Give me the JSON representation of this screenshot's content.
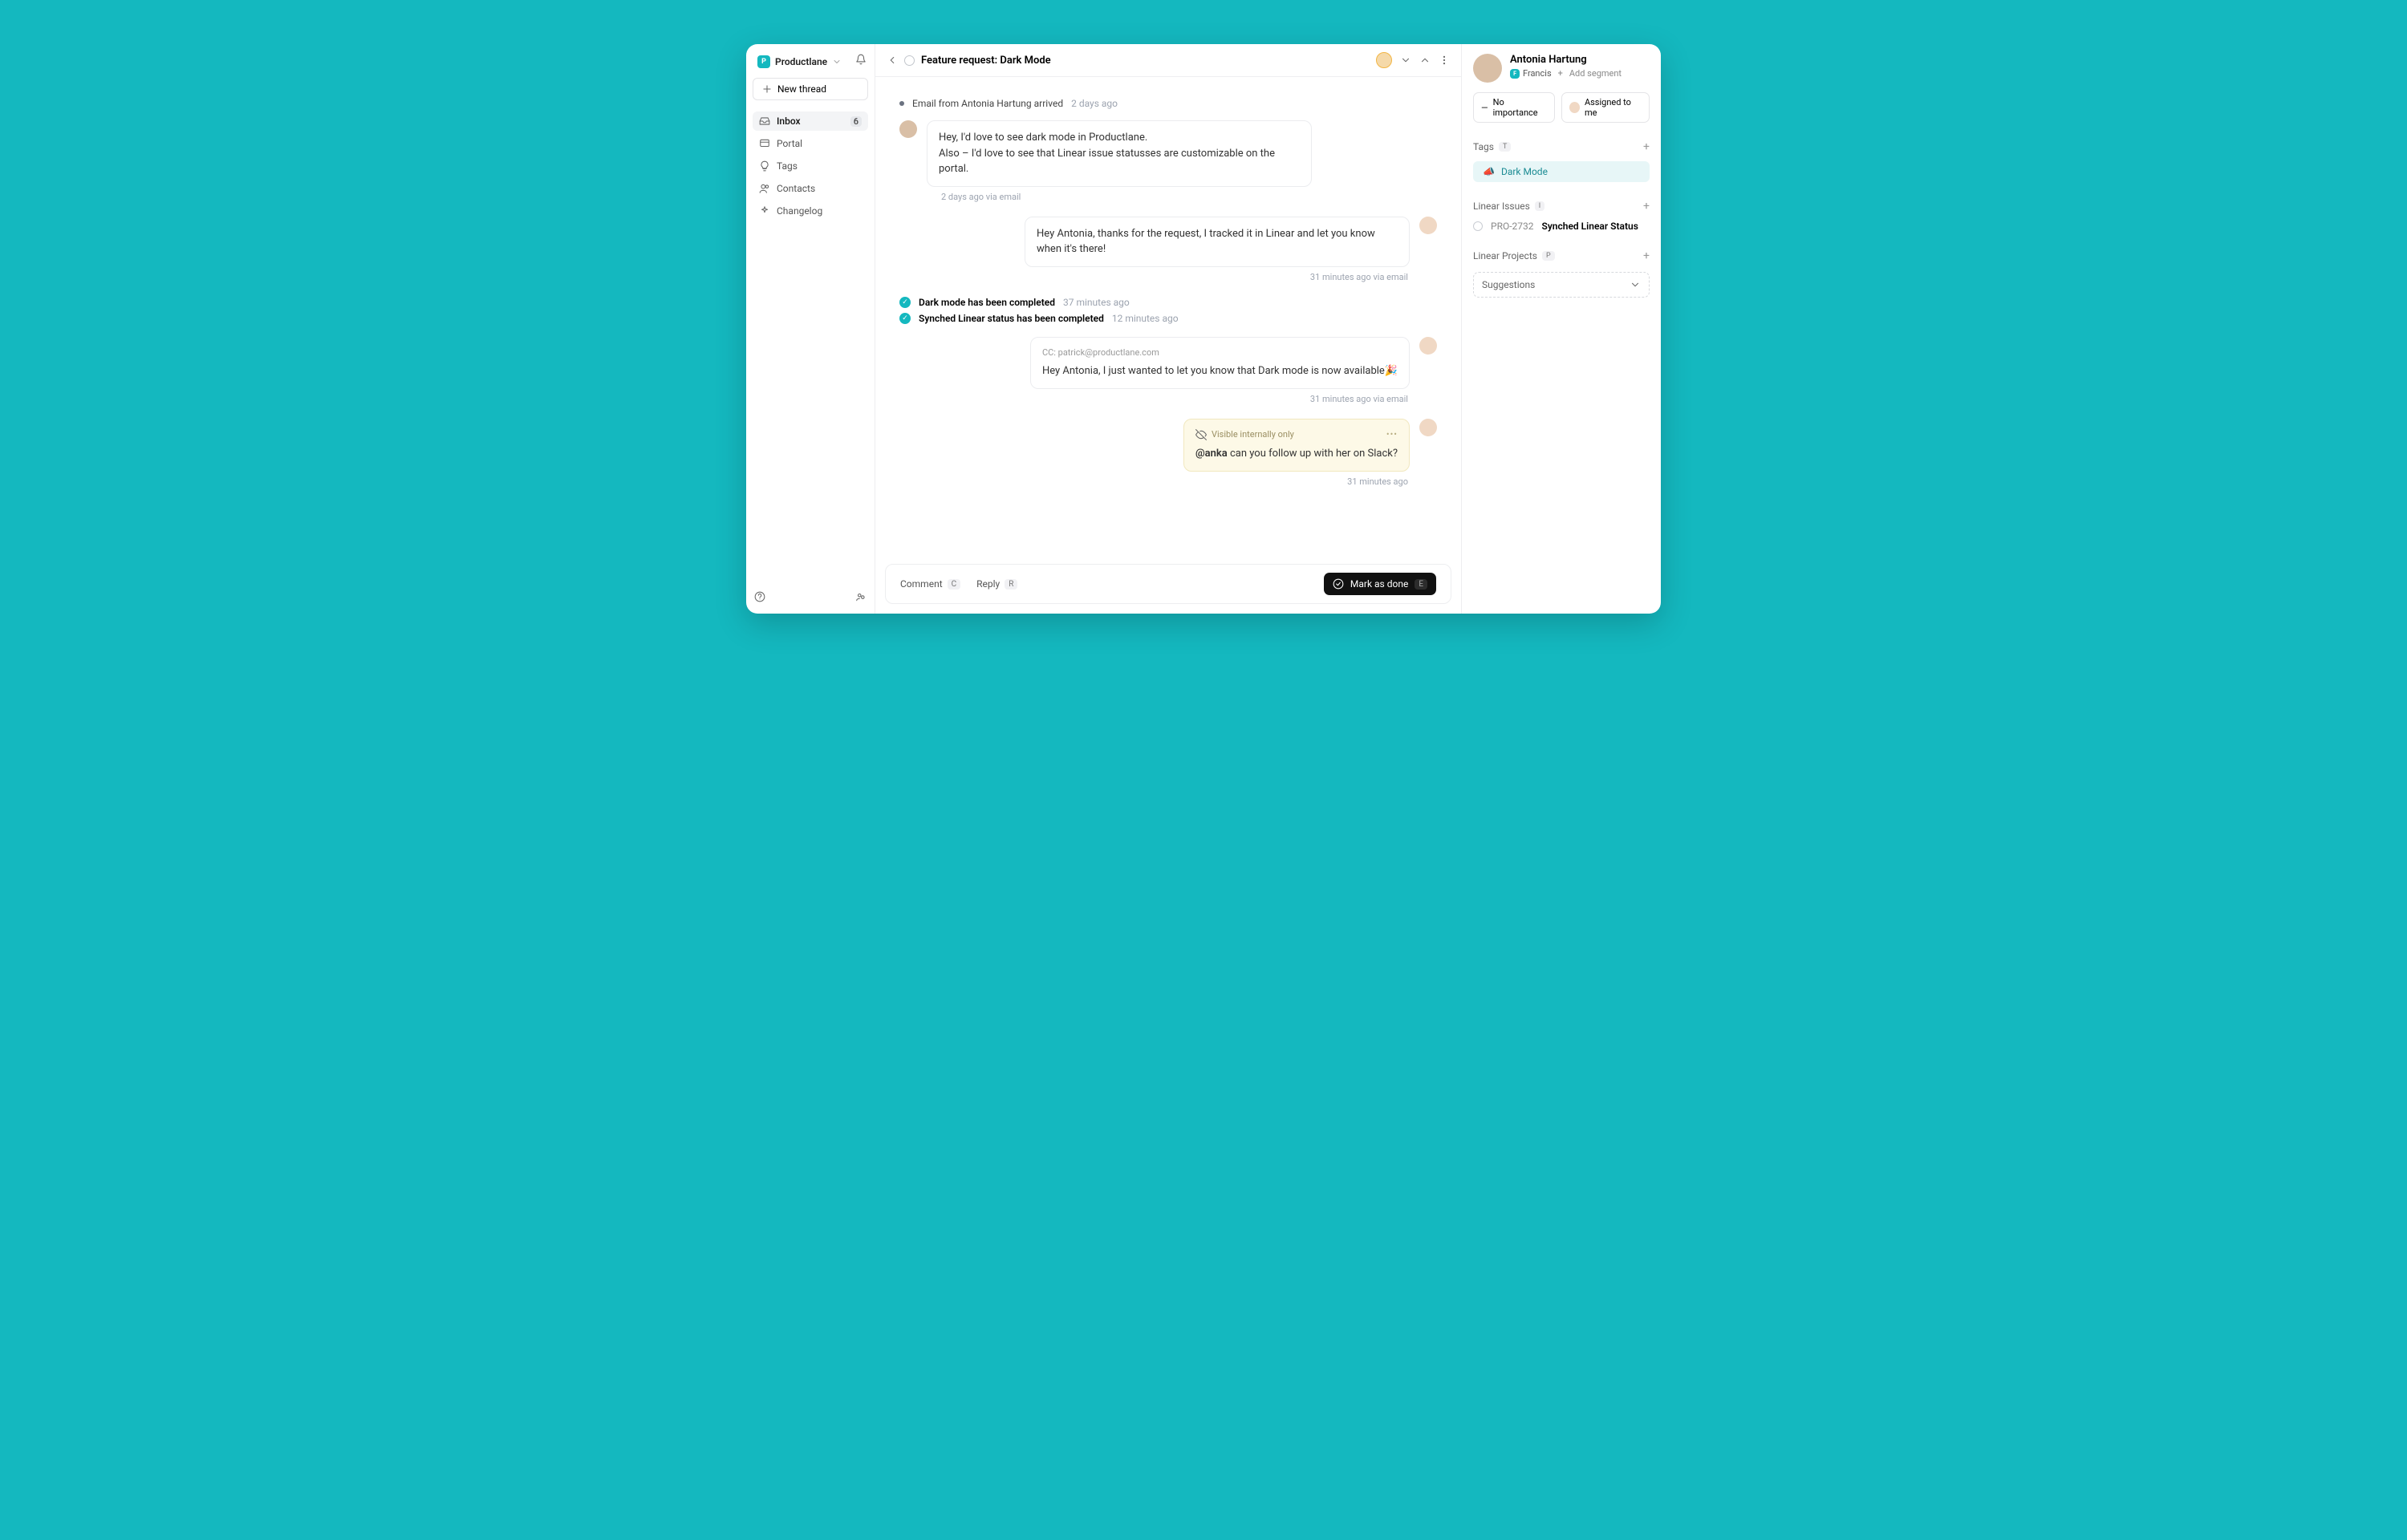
{
  "workspace": {
    "name": "Productlane"
  },
  "sidebar": {
    "new_thread": "New thread",
    "items": [
      {
        "label": "Inbox",
        "count": "6"
      },
      {
        "label": "Portal"
      },
      {
        "label": "Tags"
      },
      {
        "label": "Contacts"
      },
      {
        "label": "Changelog"
      }
    ]
  },
  "thread": {
    "title": "Feature request: Dark Mode",
    "arrival": {
      "text": "Email from Antonia Hartung arrived",
      "ts": "2 days ago"
    },
    "msg1": {
      "line1": "Hey, I'd love to see dark mode in Productlane.",
      "line2": "Also – I'd love to see that Linear issue statusses are customizable on the portal.",
      "ts": "2 days ago via email"
    },
    "msg2": {
      "text": "Hey Antonia, thanks for the request, I tracked it in Linear and let you know when it's there!",
      "ts": "31 minutes ago via email"
    },
    "done_events": [
      {
        "text": "Dark mode has been completed",
        "ts": "37 minutes ago"
      },
      {
        "text": "Synched Linear status has been completed",
        "ts": "12 minutes ago"
      }
    ],
    "msg3": {
      "cc": "CC: patrick@productlane.com",
      "text": "Hey Antonia, I just wanted to let you know that Dark mode is now available🎉",
      "ts": "31 minutes ago via email"
    },
    "msg4": {
      "badge": "Visible internally only",
      "mention": "@anka",
      "rest": " can you follow up with her on Slack?",
      "ts": "31 minutes ago"
    },
    "footer": {
      "comment": "Comment",
      "comment_k": "C",
      "reply": "Reply",
      "reply_k": "R",
      "done": "Mark as done",
      "done_k": "E"
    }
  },
  "right": {
    "contact_name": "Antonia Hartung",
    "company": "Francis",
    "add_segment": "Add segment",
    "importance": "No importance",
    "assigned": "Assigned to me",
    "tags_label": "Tags",
    "tags_k": "T",
    "tag_value": "Dark Mode",
    "issues_label": "Linear Issues",
    "issues_k": "I",
    "issue_id": "PRO-2732",
    "issue_name": "Synched Linear Status",
    "projects_label": "Linear Projects",
    "projects_k": "P",
    "suggestions": "Suggestions"
  }
}
